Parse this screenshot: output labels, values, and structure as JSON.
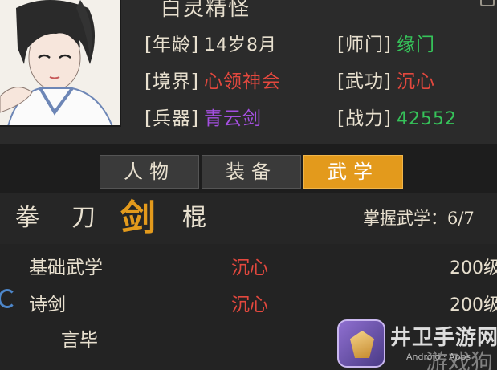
{
  "character": {
    "name": "白灵精怪",
    "attributes": {
      "age": {
        "label": "[年龄]",
        "value": "14岁8月"
      },
      "sect": {
        "label": "[师门]",
        "value": "缘门",
        "color": "#36c35a"
      },
      "realm": {
        "label": "[境界]",
        "value": "心领神会",
        "color": "#e3483e"
      },
      "martial_art": {
        "label": "[武功]",
        "value": "沉心",
        "color": "#e3483e"
      },
      "weapon": {
        "label": "[兵器]",
        "value": "青云剑",
        "color": "#a44fe0"
      },
      "combat_power": {
        "label": "[战力]",
        "value": "42552",
        "color": "#36c35a"
      }
    }
  },
  "tabs": [
    {
      "label": "人物",
      "active": false
    },
    {
      "label": "装备",
      "active": false
    },
    {
      "label": "武学",
      "active": true
    }
  ],
  "weapon_filters": [
    {
      "label": "拳",
      "active": false
    },
    {
      "label": "刀",
      "active": false
    },
    {
      "label": "剑",
      "active": true
    },
    {
      "label": "棍",
      "active": false
    }
  ],
  "mastery_text": "掌握武学：6/7",
  "skills": [
    {
      "name": "基础武学",
      "art": "沉心",
      "level": "200级"
    },
    {
      "name": "诗剑",
      "art": "沉心",
      "level": "200级"
    },
    {
      "name": "言毕",
      "art": "",
      "level": ""
    }
  ],
  "watermark": {
    "site_name": "井卫手游网",
    "site_sub": "Android · Apps",
    "game_text": "游戏狗"
  },
  "colors": {
    "accent": "#e39a1c",
    "green": "#36c35a",
    "red": "#e3483e",
    "purple": "#a44fe0"
  }
}
